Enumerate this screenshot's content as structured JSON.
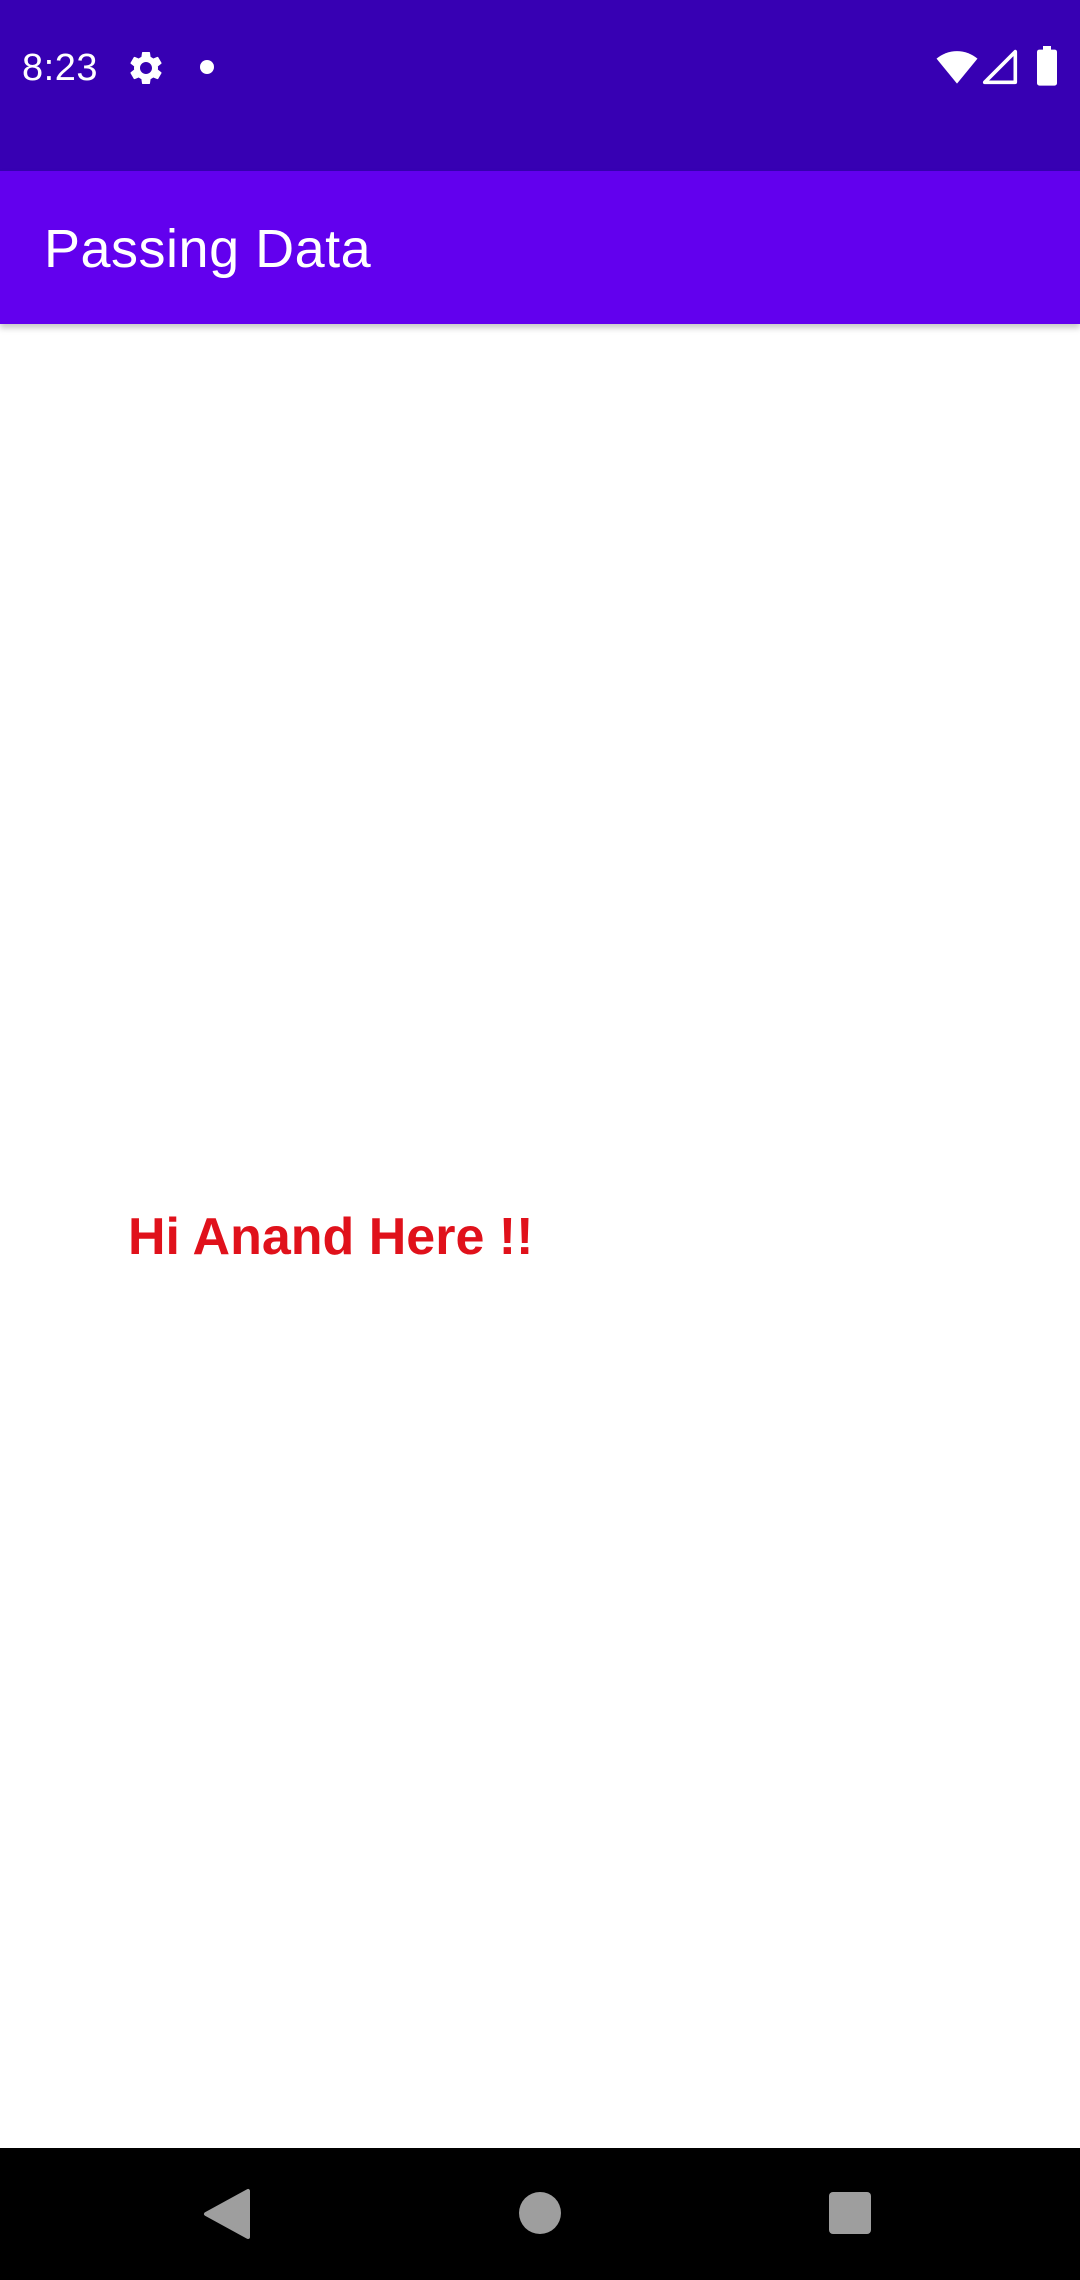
{
  "status_bar": {
    "time": "8:23",
    "icons": [
      "gear-icon",
      "notification-dot-icon",
      "wifi-icon",
      "cell-signal-icon",
      "battery-icon"
    ],
    "background": "#3700b3"
  },
  "app_bar": {
    "title": "Passing Data",
    "background": "#6200ee"
  },
  "content": {
    "greeting": "Hi Anand Here !!",
    "greeting_color": "#e0111b"
  },
  "nav_bar": {
    "icons": [
      "back-icon",
      "home-icon",
      "recents-icon"
    ]
  }
}
